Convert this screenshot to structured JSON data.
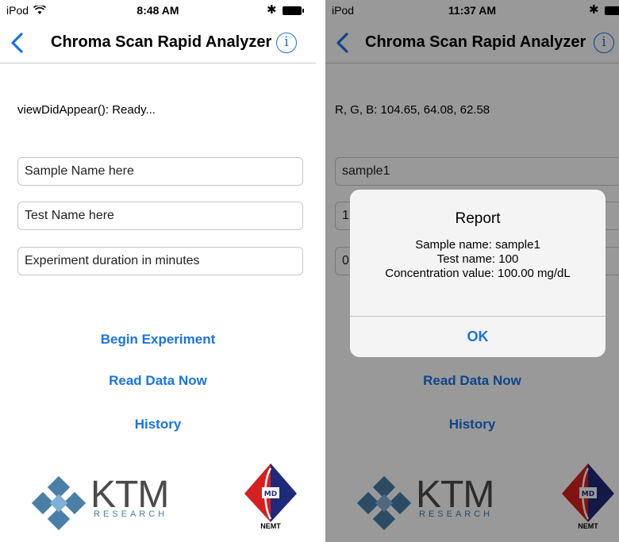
{
  "left": {
    "status_bar": {
      "carrier": "iPod",
      "time": "8:48 AM"
    },
    "nav": {
      "title": "Chroma Scan Rapid Analyzer",
      "info_icon_text": "i"
    },
    "status_text": "viewDidAppear(): Ready...",
    "fields": {
      "sample_placeholder": "Sample Name here",
      "test_placeholder": "Test Name here",
      "duration_placeholder": "Experiment duration in minutes"
    },
    "actions": {
      "begin": "Begin Experiment",
      "read": "Read Data Now",
      "history": "History"
    }
  },
  "right": {
    "status_bar": {
      "carrier": "iPod",
      "time": "11:37 AM"
    },
    "nav": {
      "title": "Chroma Scan Rapid Analyzer",
      "info_icon_text": "i"
    },
    "status_text": "R, G, B: 104.65, 64.08, 62.58",
    "fields": {
      "sample_value": "sample1",
      "test_value_partial": "1",
      "duration_value_partial": "0"
    },
    "actions": {
      "read": "Read Data Now",
      "history": "History"
    },
    "alert": {
      "title": "Report",
      "line1": "Sample name: sample1",
      "line2": "Test name: 100",
      "line3": "Concentration value: 100.00 mg/dL",
      "ok": "OK"
    }
  },
  "logos": {
    "ktm_main": "KTM",
    "ktm_sub": "RESEARCH",
    "nemt_label": "NEMT",
    "nemt_inner": "MD"
  },
  "colors": {
    "accent": "#1a73e8",
    "logo_blue": "#4a7fa8",
    "logo_red": "#d62020",
    "logo_navy": "#1f2a7a"
  }
}
